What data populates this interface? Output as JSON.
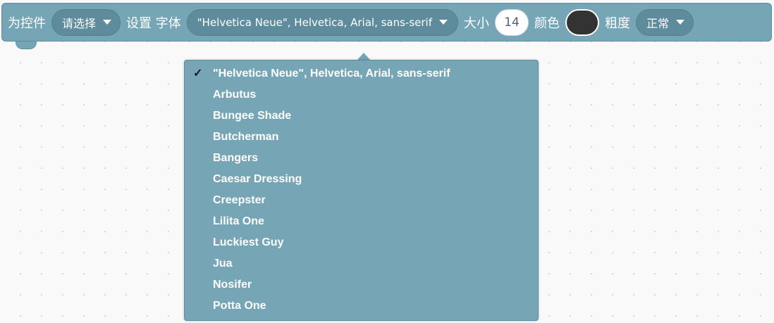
{
  "block": {
    "label_for_widget": "为控件",
    "target_dropdown_value": "请选择",
    "label_set_font": "设置 字体",
    "font_dropdown_value": "\"Helvetica Neue\", Helvetica, Arial, sans-serif",
    "label_size": "大小",
    "size_value": "14",
    "label_color": "颜色",
    "color_value": "#333333",
    "label_weight": "粗度",
    "weight_dropdown_value": "正常",
    "block_color": "#76a5b6"
  },
  "font_menu": {
    "check_mark": "✓",
    "selected_index": 0,
    "options": [
      "\"Helvetica Neue\", Helvetica, Arial, sans-serif",
      "Arbutus",
      "Bungee Shade",
      "Butcherman",
      "Bangers",
      "Caesar Dressing",
      "Creepster",
      "Lilita One",
      "Luckiest Guy",
      "Jua",
      "Nosifer",
      "Potta One"
    ]
  }
}
